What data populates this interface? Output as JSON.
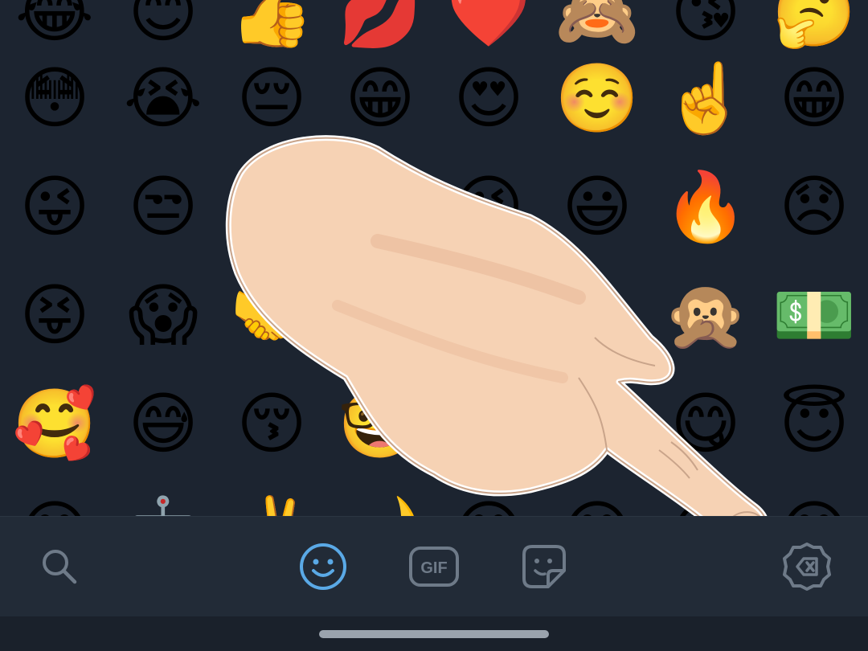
{
  "emoji_grid": {
    "rows": [
      [
        "😂",
        "😊",
        "👍",
        "💋",
        "❤️",
        "🙈",
        "😘",
        "🤔"
      ],
      [
        "😳",
        "😭",
        "😔",
        "😁",
        "😍",
        "☺️",
        "☝️",
        "😁"
      ],
      [
        "😜",
        "😒",
        "",
        "",
        "😉",
        "😃",
        "🔥",
        "😞"
      ],
      [
        "😝",
        "😱",
        "🤝",
        "",
        "",
        "",
        "🙊",
        "💵"
      ],
      [
        "🥰",
        "😅",
        "😚",
        "🤓",
        "",
        "",
        "😋",
        "😇"
      ],
      [
        "😊",
        "🤖",
        "✌️",
        "🌙",
        "😊",
        "😊",
        "😊",
        "😊"
      ]
    ]
  },
  "toolbar": {
    "tabs": [
      {
        "name": "search",
        "icon": "search-icon",
        "active": false
      },
      {
        "name": "emoji",
        "icon": "smiley-icon",
        "active": true
      },
      {
        "name": "gif",
        "icon": "gif-icon",
        "label": "GIF",
        "active": false
      },
      {
        "name": "stickers",
        "icon": "sticker-icon",
        "active": false
      },
      {
        "name": "backspace",
        "icon": "backspace-icon",
        "active": false
      }
    ]
  },
  "colors": {
    "background": "#1c2430",
    "toolbar": "#222b37",
    "icon_inactive": "#6e7a88",
    "icon_active": "#5aa9e6"
  }
}
